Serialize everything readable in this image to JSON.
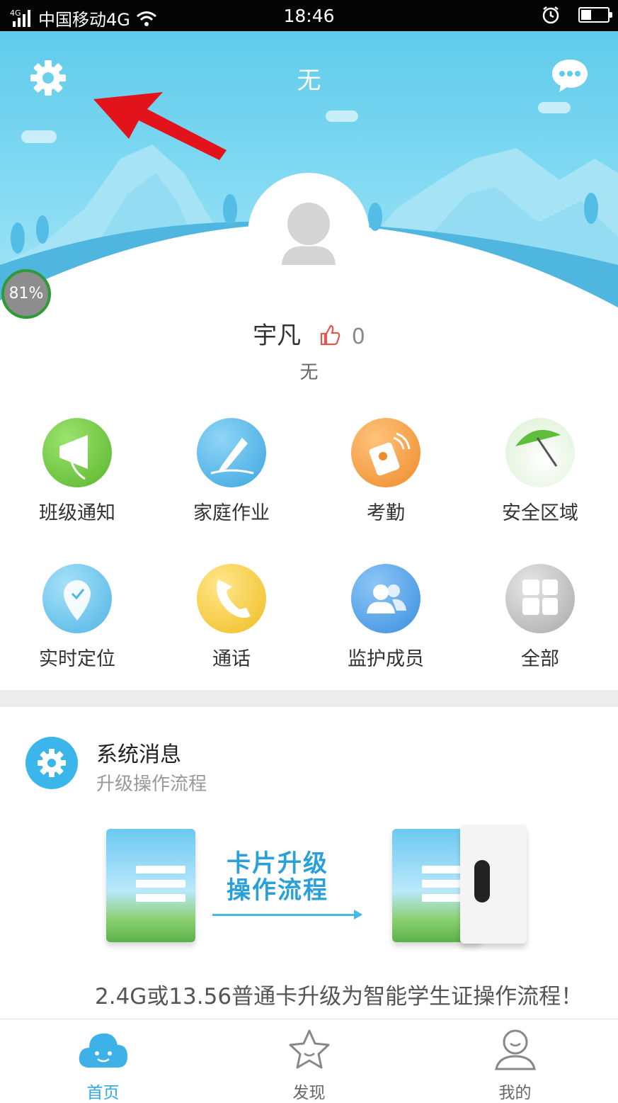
{
  "status_bar": {
    "network_tag": "4G",
    "carrier": "中国移动4G",
    "time": "18:46",
    "icons": [
      "signal-icon",
      "wifi-icon",
      "alarm-icon",
      "battery-icon"
    ]
  },
  "header": {
    "title": "无",
    "settings_icon": "gear-icon",
    "message_icon": "chat-bubble-icon"
  },
  "profile": {
    "name": "宇凡",
    "likes": "0",
    "subtitle": "无",
    "device_battery": "81%"
  },
  "features": [
    {
      "label": "班级通知",
      "icon": "megaphone-icon",
      "color": "#6cc43a"
    },
    {
      "label": "家庭作业",
      "icon": "pencil-icon",
      "color": "#45b0e8"
    },
    {
      "label": "考勤",
      "icon": "attendance-card-icon",
      "color": "#f39a3a"
    },
    {
      "label": "安全区域",
      "icon": "umbrella-icon",
      "color": "#8fd46c"
    },
    {
      "label": "实时定位",
      "icon": "location-pin-icon",
      "color": "#59bdea"
    },
    {
      "label": "通话",
      "icon": "phone-icon",
      "color": "#f5c93a"
    },
    {
      "label": "监护成员",
      "icon": "members-icon",
      "color": "#4a9ee6"
    },
    {
      "label": "全部",
      "icon": "grid-icon",
      "color": "#b9b9b9"
    }
  ],
  "system_message": {
    "title": "系统消息",
    "subtitle": "升级操作流程",
    "banner_line1": "卡片升级",
    "banner_line2": "操作流程",
    "description": "2.4G或13.56普通卡升级为智能学生证操作流程！"
  },
  "tabs": [
    {
      "label": "首页",
      "icon": "home-cloud-icon",
      "active": true
    },
    {
      "label": "发现",
      "icon": "star-icon",
      "active": false
    },
    {
      "label": "我的",
      "icon": "person-icon",
      "active": false
    }
  ],
  "colors": {
    "header_sky": "#5fcbea",
    "accent_blue": "#2fa8e3",
    "annotation_arrow": "#e3131b"
  }
}
